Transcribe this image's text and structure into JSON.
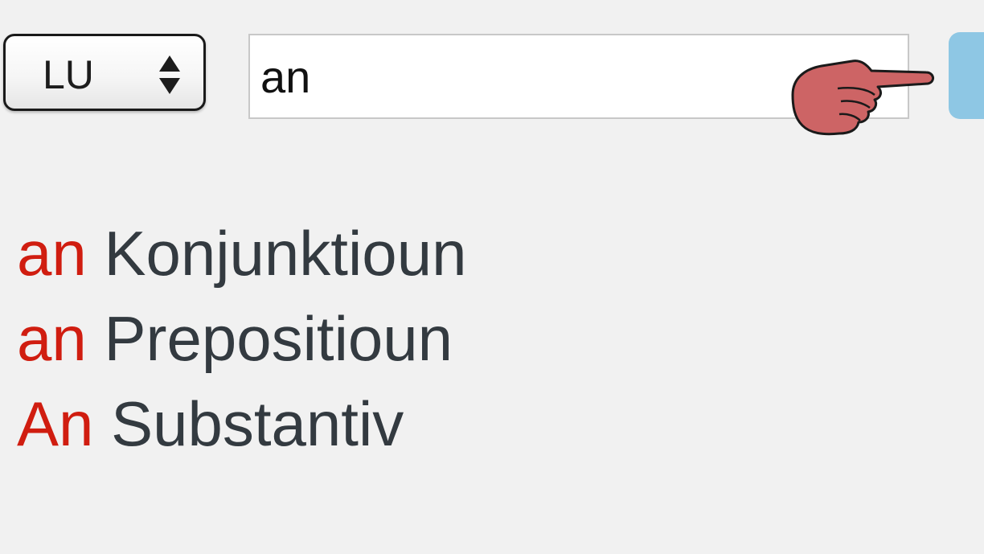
{
  "language_select": {
    "value": "LU",
    "icon": "up-down-arrows-icon"
  },
  "search": {
    "value": "an",
    "button_color": "#8ec7e4"
  },
  "cursor": {
    "icon": "pointing-hand-icon",
    "color": "#cd6465"
  },
  "results": [
    {
      "term": "an",
      "pos": "Konjunktioun"
    },
    {
      "term": "an",
      "pos": "Prepositioun"
    },
    {
      "term": "An",
      "pos": "Substantiv"
    }
  ],
  "colors": {
    "background": "#f1f1f1",
    "term": "#d01d10",
    "pos": "#333a40"
  }
}
